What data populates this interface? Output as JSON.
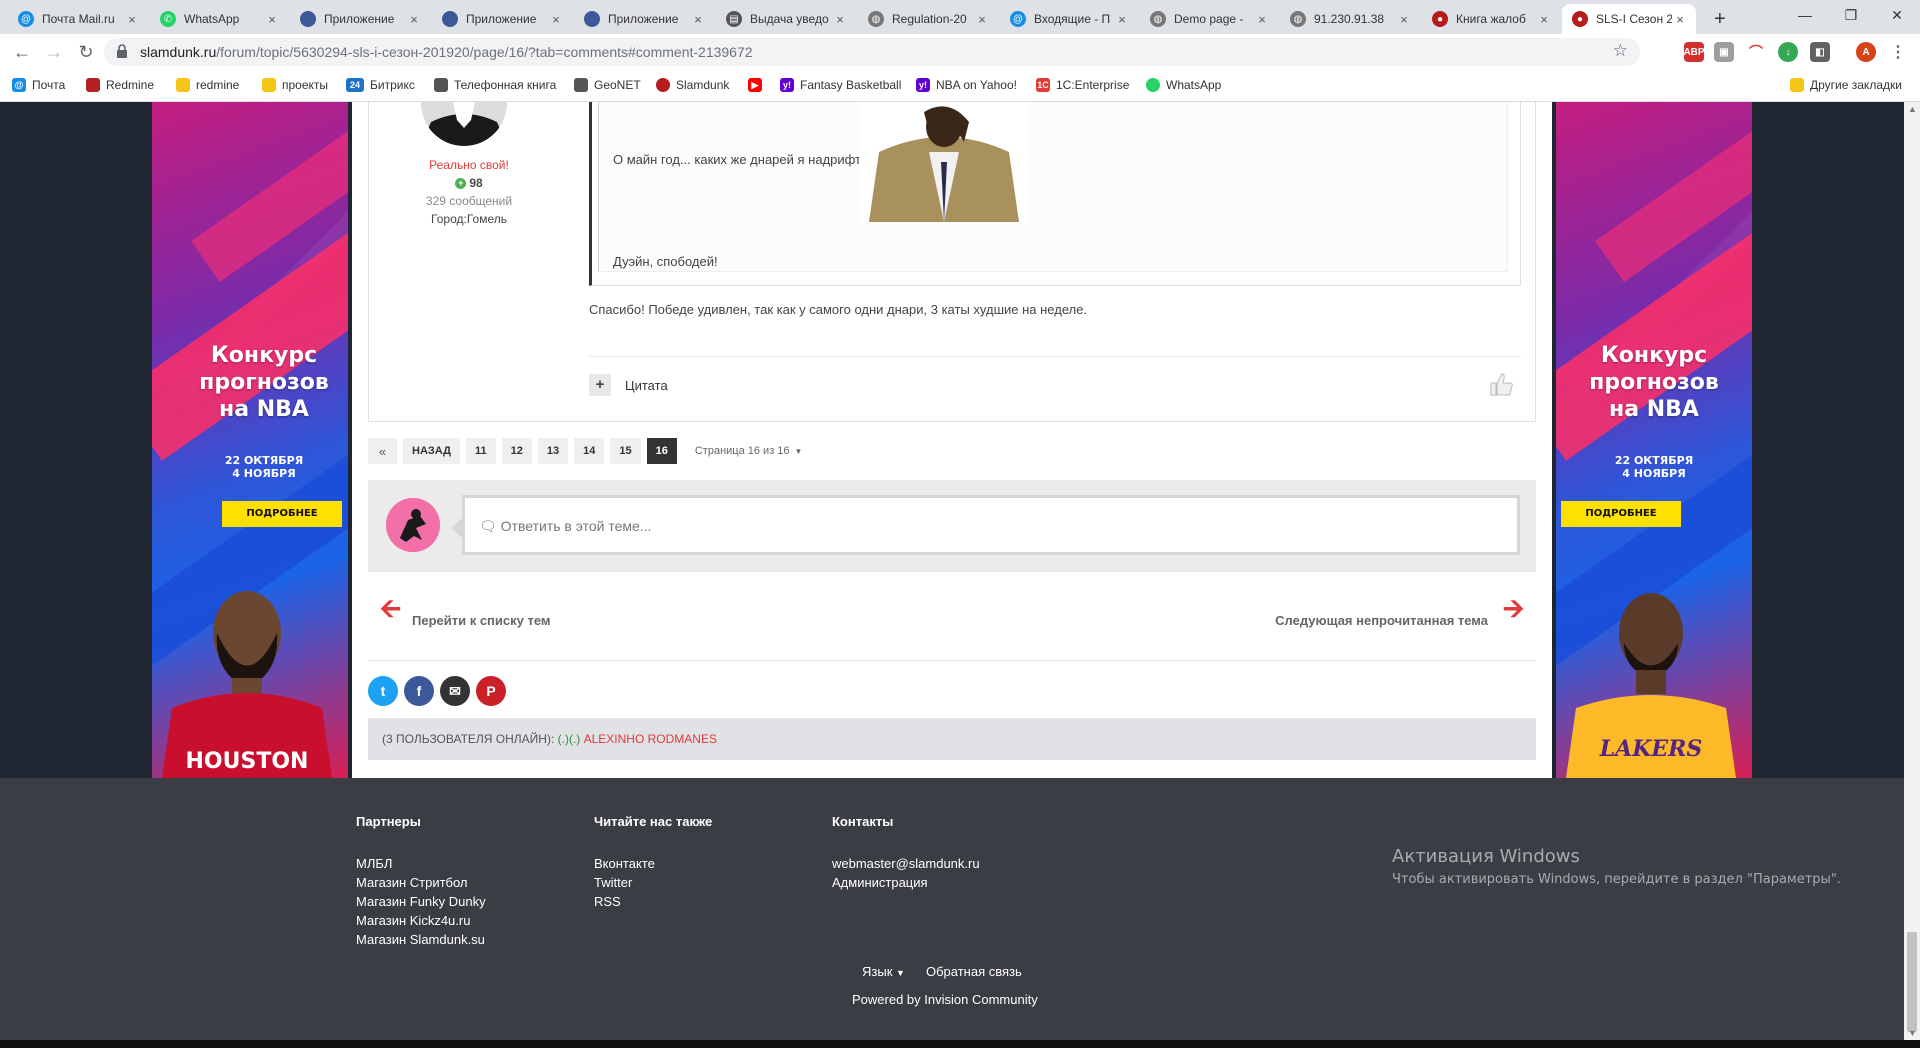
{
  "browser": {
    "tabs": [
      {
        "title": "Почта Mail.ru",
        "color": "#168de2"
      },
      {
        "title": "WhatsApp",
        "color": "#25d366"
      },
      {
        "title": "Приложение",
        "color": "#3b5998"
      },
      {
        "title": "Приложение",
        "color": "#3b5998"
      },
      {
        "title": "Приложение",
        "color": "#3b5998"
      },
      {
        "title": "Выдача уведо",
        "color": "#555555"
      },
      {
        "title": "Regulation-20",
        "color": "#777777"
      },
      {
        "title": "Входящие - П",
        "color": "#168de2"
      },
      {
        "title": "Demo page -",
        "color": "#777777"
      },
      {
        "title": "91.230.91.38",
        "color": "#777777"
      },
      {
        "title": "Книга жалоб",
        "color": "#b71c1c"
      },
      {
        "title": "SLS-I Сезон 2",
        "color": "#b71c1c"
      }
    ],
    "new_tab": "+",
    "close_glyph": "×",
    "url_domain": "slamdunk.ru",
    "url_path": "/forum/topic/5630294-sls-i-сезон-201920/page/16/?tab=comments#comment-2139672",
    "profile_letter": "A",
    "bookmarks": [
      {
        "label": "Почта",
        "color": "#168de2"
      },
      {
        "label": "Redmine",
        "color": "#b32024"
      },
      {
        "label": "redmine",
        "color": "#f5c518"
      },
      {
        "label": "проекты",
        "color": "#f5c518"
      },
      {
        "label": "Битрикс",
        "color": "#1f73c4",
        "glyph": "24"
      },
      {
        "label": "Телефонная книга",
        "color": "#555555"
      },
      {
        "label": "GeoNET",
        "color": "#555555"
      },
      {
        "label": "Slamdunk",
        "color": "#b71c1c"
      },
      {
        "label": "",
        "color": "#ff0000"
      },
      {
        "label": "Fantasy Basketball",
        "color": "#6001d2"
      },
      {
        "label": "NBA on Yahoo!",
        "color": "#6001d2"
      },
      {
        "label": "1C:Enterprise",
        "color": "#e53935"
      },
      {
        "label": "WhatsApp",
        "color": "#25d366"
      }
    ],
    "other_bookmarks": "Другие закладки"
  },
  "banner": {
    "title_line1": "Конкурс",
    "title_line2": "прогнозов",
    "title_line3": "на NBA",
    "dates_line1": "22 ОКТЯБРЯ",
    "dates_line2": "4 НОЯБРЯ",
    "button": "ПОДРОБНЕЕ"
  },
  "post": {
    "author_rank": "Реально свой!",
    "reputation": "98",
    "post_count": "329 сообщений",
    "city": "Город:Гомель",
    "quote_line1": "О майн год... каких же днарей я надрифтил",
    "quote_line2": "Дуэйн, спободей!",
    "text": "Спасибо! Победе удивлен, так как у самого одни днари, 3 каты худшие на неделе.",
    "quote_button": "Цитата"
  },
  "pagination": {
    "first": "«",
    "prev": "НАЗАД",
    "pages": [
      "11",
      "12",
      "13",
      "14",
      "15",
      "16"
    ],
    "current": "16",
    "info": "Страница 16 из 16"
  },
  "reply": {
    "placeholder": "Ответить в этой теме..."
  },
  "topic_nav": {
    "prev_label": "Перейти к списку тем",
    "next_label": "Следующая непрочитанная тема"
  },
  "online": {
    "label": "(3 ПОЛЬЗОВАТЕЛЯ ОНЛАЙН):",
    "users_green": "(.)(.)",
    "users_red": "ALEXINHO RODMANES"
  },
  "footer": {
    "col1_title": "Партнеры",
    "col1_links": [
      "МЛБЛ",
      "Магазин Стритбол",
      "Магазин Funky Dunky",
      "Магазин Kickz4u.ru",
      "Магазин Slamdunk.su"
    ],
    "col2_title": "Читайте нас также",
    "col2_links": [
      "Вконтакте",
      "Twitter",
      "RSS"
    ],
    "col3_title": "Контакты",
    "col3_links": [
      "webmaster@slamdunk.ru",
      "Администрация"
    ],
    "language": "Язык",
    "feedback": "Обратная связь",
    "powered": "Powered by Invision Community"
  },
  "windows_activation": {
    "title": "Активация Windows",
    "subtitle": "Чтобы активировать Windows, перейдите в раздел \"Параметры\"."
  }
}
